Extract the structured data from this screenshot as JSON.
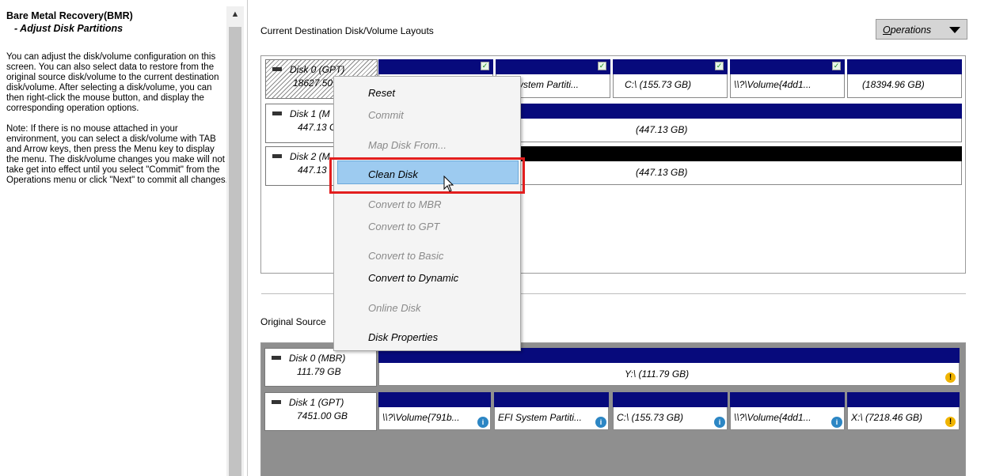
{
  "left_panel": {
    "title": "Bare Metal Recovery(BMR)",
    "subtitle": "- Adjust Disk Partitions",
    "paragraphs": [
      "You can adjust the disk/volume configuration on this screen. You can also select data to restore from the original source disk/volume to the current destination disk/volume. After selecting a disk/volume, you can then right-click the mouse button, and display the corresponding operation options.",
      "Note: If there is no mouse attached in your environment, you can select a disk/volume with TAB and Arrow keys, then press the Menu key to display the menu. The disk/volume changes you make will not take get into effect until you select \"Commit\" from the Operations menu or click \"Next\" to commit all changes."
    ]
  },
  "destination": {
    "header": "Current Destination Disk/Volume Layouts",
    "operations_label": "Operations",
    "operations_underline": "O",
    "operations_rest": "perations",
    "disks": [
      {
        "name": "Disk 0 (GPT)",
        "size": "18627.50 GB",
        "name_visible": "Disk 0 (GPT)",
        "size_visible": "18627.50"
      },
      {
        "name": "Disk 1 (MBR)",
        "size": "447.13 GB",
        "name_visible": "Disk 1 (M",
        "size_visible": "447.13 G",
        "volume": "(447.13 GB)"
      },
      {
        "name": "Disk 2 (MBR)",
        "size": "447.13 GB",
        "name_visible": "Disk 2 (M",
        "size_visible": "447.13",
        "volume": "(447.13 GB)"
      }
    ],
    "disk0_partitions": [
      "ystem Partiti...",
      "C:\\ (155.73 GB)",
      "\\\\?\\Volume{4dd1...",
      "(18394.96 GB)"
    ]
  },
  "context_menu": {
    "items": [
      {
        "label": "Reset",
        "enabled": true
      },
      {
        "label": "Commit",
        "enabled": false
      },
      {
        "label": "Map Disk From...",
        "enabled": false
      },
      {
        "label": "Clean Disk",
        "enabled": true
      },
      {
        "label": "Convert to MBR",
        "enabled": false
      },
      {
        "label": "Convert to GPT",
        "enabled": false
      },
      {
        "label": "Convert to Basic",
        "enabled": false
      },
      {
        "label": "Convert to Dynamic",
        "enabled": true
      },
      {
        "label": "Online Disk",
        "enabled": false
      },
      {
        "label": "Disk Properties",
        "enabled": true
      }
    ]
  },
  "source": {
    "header": "Original Source",
    "disks": [
      {
        "name": "Disk 0 (MBR)",
        "size": "111.79 GB",
        "volume": "Y:\\ (111.79 GB)"
      },
      {
        "name": "Disk 1 (GPT)",
        "size": "7451.00 GB",
        "partitions": [
          "\\\\?\\Volume{791b...",
          "EFI System Partiti...",
          "C:\\ (155.73 GB)",
          "\\\\?\\Volume{4dd1...",
          "X:\\ (7218.46 GB)"
        ]
      }
    ]
  },
  "colors": {
    "partition_bar": "#070a7c",
    "highlight": "#9dcbf0",
    "red_outline": "#e21e1e"
  }
}
